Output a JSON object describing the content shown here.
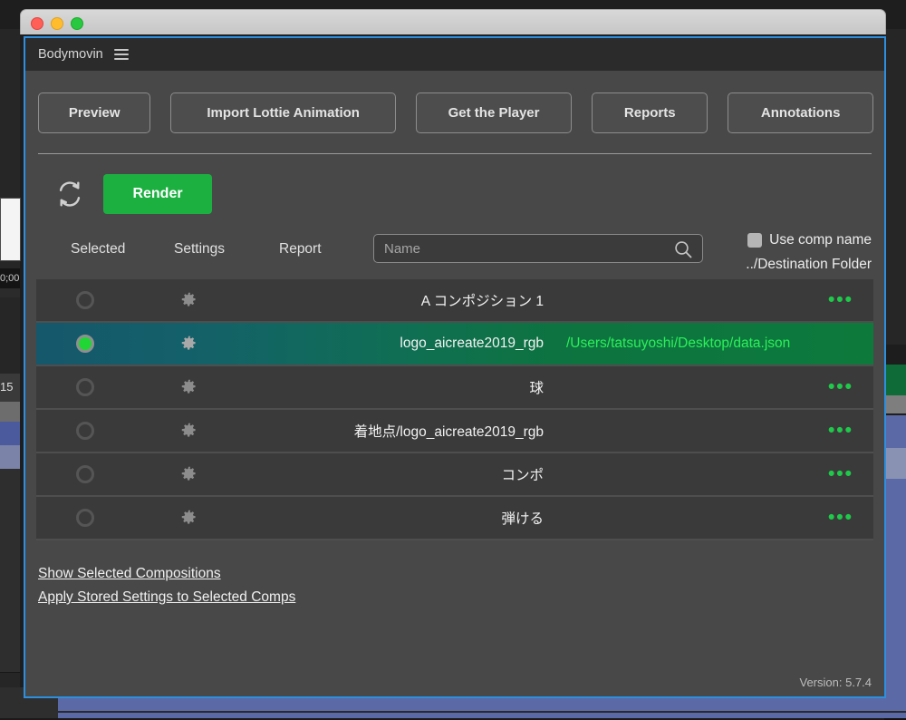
{
  "window": {
    "traffic_lights": [
      "close",
      "minimize",
      "zoom"
    ]
  },
  "panel": {
    "title": "Bodymovin",
    "menu_icon": "hamburger-icon",
    "version": "Version: 5.7.4"
  },
  "toolbar": {
    "buttons": [
      {
        "label": "Preview"
      },
      {
        "label": "Import Lottie Animation"
      },
      {
        "label": "Get the Player"
      },
      {
        "label": "Reports"
      },
      {
        "label": "Annotations"
      }
    ]
  },
  "render": {
    "refresh_icon": "refresh-icon",
    "button_label": "Render",
    "button_color": "#1cb041"
  },
  "list_header": {
    "selected_label": "Selected",
    "settings_label": "Settings",
    "report_label": "Report"
  },
  "search": {
    "placeholder": "Name",
    "value": "",
    "icon": "search-icon"
  },
  "options": {
    "use_comp_name_label": "Use comp name",
    "use_comp_name_checked": false,
    "destination_folder_label": "../Destination Folder"
  },
  "compositions": [
    {
      "name": "A コンポジション 1",
      "selected": false,
      "path": "",
      "menu": "•••"
    },
    {
      "name": "logo_aicreate2019_rgb",
      "selected": true,
      "path": "/Users/tatsuyoshi/Desktop/data.json",
      "menu": ""
    },
    {
      "name": "球",
      "selected": false,
      "path": "",
      "menu": "•••"
    },
    {
      "name": "着地点/logo_aicreate2019_rgb",
      "selected": false,
      "path": "",
      "menu": "•••"
    },
    {
      "name": "コンポ",
      "selected": false,
      "path": "",
      "menu": "•••"
    },
    {
      "name": "弾ける",
      "selected": false,
      "path": "",
      "menu": "•••"
    }
  ],
  "footer": {
    "links": [
      {
        "label": "Show Selected Compositions"
      },
      {
        "label": "Apply Stored Settings to Selected Comps"
      }
    ]
  },
  "background": {
    "timecode": "0;00",
    "frame_number": "15"
  }
}
